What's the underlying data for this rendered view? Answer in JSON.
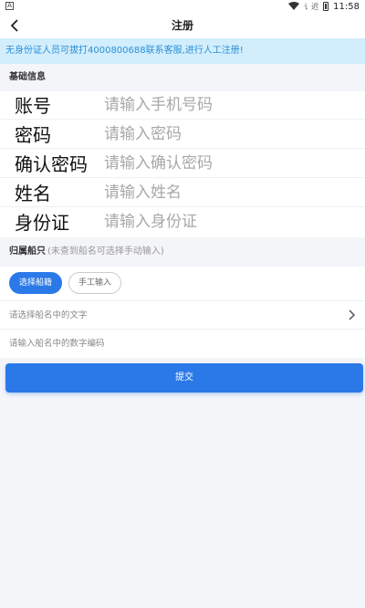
{
  "status_bar": {
    "app_icon_letter": "A",
    "signal_text": "讠迟",
    "time": "11:58",
    "icons": [
      "wifi-icon",
      "signal-icon",
      "battery-icon"
    ]
  },
  "navbar": {
    "back_icon": "chevron-left-icon",
    "title": "注册"
  },
  "notice": {
    "text": "无身份证人员可拔打4000800688联系客服,进行人工注册!"
  },
  "basic_info": {
    "section_title": "基础信息",
    "fields": [
      {
        "label": "账号",
        "placeholder": "请输入手机号码",
        "value": ""
      },
      {
        "label": "密码",
        "placeholder": "请输入密码",
        "value": ""
      },
      {
        "label": "确认密码",
        "placeholder": "请输入确认密码",
        "value": ""
      },
      {
        "label": "姓名",
        "placeholder": "请输入姓名",
        "value": ""
      },
      {
        "label": "身份证",
        "placeholder": "请输入身份证",
        "value": ""
      }
    ]
  },
  "ship": {
    "section_title": "归属船只",
    "section_hint": "(未查到船名可选择手动输入)",
    "chips": {
      "select": "选择船籍",
      "manual": "手工输入"
    },
    "name_placeholder": "请选择船名中的文字",
    "code_placeholder": "请输入船名中的数字编码",
    "chevron_icon": "chevron-right-icon"
  },
  "submit_label": "提交",
  "colors": {
    "accent": "#2b79e9",
    "notice_bg": "#d2eefd",
    "notice_text": "#2a8fd6",
    "page_bg": "#f4f5f9"
  }
}
